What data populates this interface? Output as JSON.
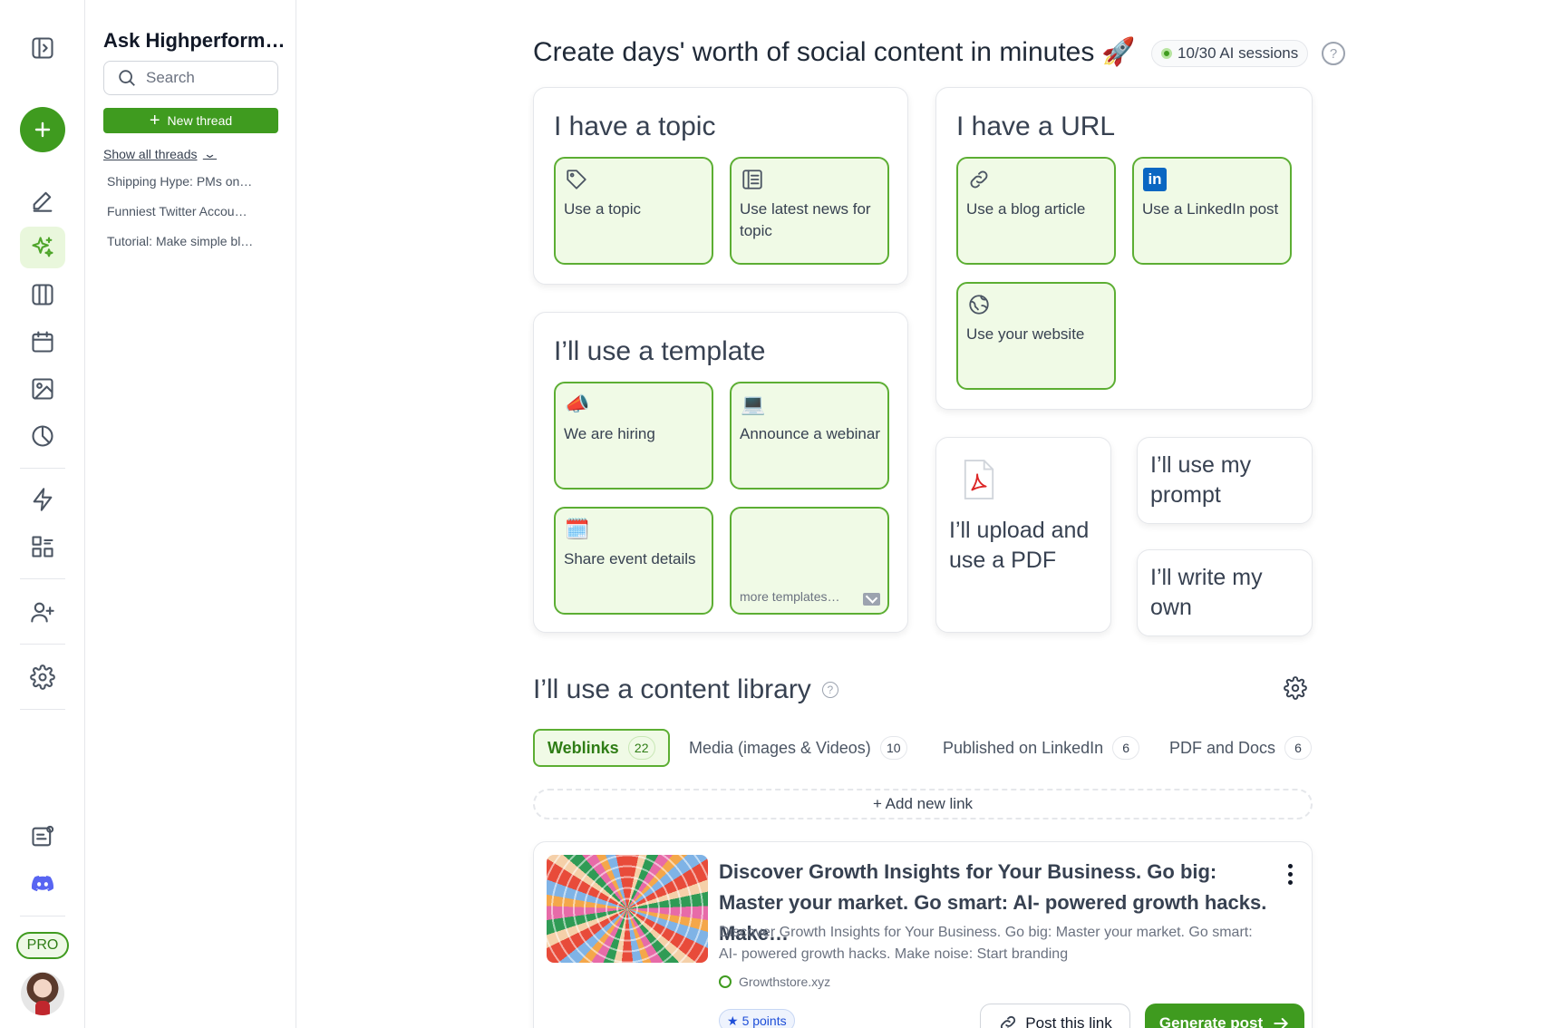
{
  "threads": {
    "title": "Ask Highperform…",
    "search_placeholder": "Search",
    "new_thread_label": "New thread",
    "show_all_label": "Show all threads",
    "items": [
      {
        "label": "Shipping Hype: PMs on…"
      },
      {
        "label": "Funniest Twitter Accou…"
      },
      {
        "label": "Tutorial: Make simple bl…"
      }
    ]
  },
  "rail": {
    "pro_label": "PRO"
  },
  "header": {
    "title": "Create days' worth of social content in minutes",
    "title_emoji": "🚀",
    "sessions_label": "10/30 AI sessions",
    "help_glyph": "?"
  },
  "topic_panel": {
    "title": "I have a topic",
    "tiles": [
      {
        "label": "Use a topic",
        "icon": "tag-icon"
      },
      {
        "label": "Use latest news for topic",
        "icon": "newspaper-icon"
      }
    ]
  },
  "url_panel": {
    "title": "I have a URL",
    "tiles": [
      {
        "label": "Use a blog article",
        "icon": "link-icon"
      },
      {
        "label": "Use a LinkedIn post",
        "icon": "linkedin-icon",
        "icon_text": "in"
      },
      {
        "label": "Use your website",
        "icon": "globe-icon"
      }
    ]
  },
  "template_panel": {
    "title": "I’ll use a template",
    "tiles": [
      {
        "label": "We are hiring",
        "emoji": "📣"
      },
      {
        "label": "Announce a webinar",
        "emoji": "💻"
      },
      {
        "label": "Share event details",
        "emoji": "🗓️"
      },
      {
        "label": "more templates…"
      }
    ]
  },
  "options": {
    "pdf_label": "I’ll upload and use a PDF",
    "prompt_label": "I’ll use my prompt",
    "write_label": "I’ll write my own"
  },
  "library": {
    "title": "I’ll use a content library",
    "help_glyph": "?",
    "tabs": [
      {
        "label": "Weblinks",
        "count": "22"
      },
      {
        "label": "Media (images & Videos)",
        "count": "10"
      },
      {
        "label": "Published on LinkedIn",
        "count": "6"
      },
      {
        "label": "PDF and Docs",
        "count": "6"
      }
    ],
    "add_link_label": "+ Add new link",
    "card": {
      "title": "Discover Growth Insights for Your Business. Go big: Master your market. Go smart: AI- powered growth hacks. Make…",
      "description": "Discover Growth Insights for Your Business. Go big: Master your market. Go smart: AI- powered growth hacks. Make noise: Start branding",
      "domain": "Growthstore.xyz",
      "points_label": "5 points",
      "post_button": "Post this link",
      "generate_button": "Generate post"
    }
  },
  "colors": {
    "accent": "#3f9b1f",
    "tile_bg": "#f0fae6",
    "tile_border": "#5cae33",
    "linkedin": "#0a66c2"
  }
}
